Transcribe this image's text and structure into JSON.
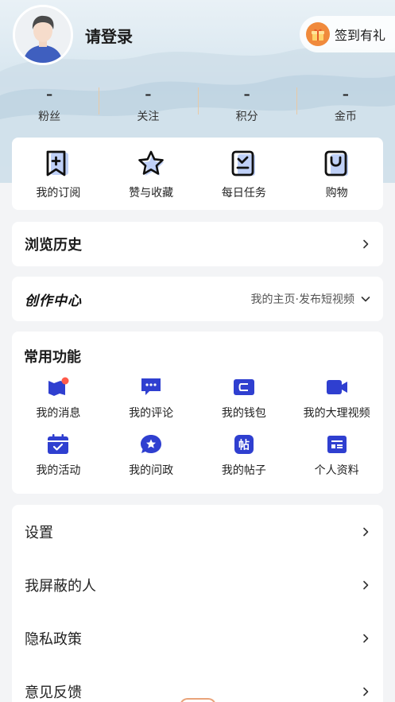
{
  "header": {
    "login_text": "请登录",
    "checkin_label": "签到有礼"
  },
  "stats": [
    {
      "value": "–",
      "label": "粉丝"
    },
    {
      "value": "–",
      "label": "关注"
    },
    {
      "value": "–",
      "label": "积分"
    },
    {
      "value": "–",
      "label": "金币"
    }
  ],
  "quick_actions": [
    {
      "label": "我的订阅",
      "icon": "bookmark-plus-icon"
    },
    {
      "label": "赞与收藏",
      "icon": "star-icon"
    },
    {
      "label": "每日任务",
      "icon": "task-check-icon"
    },
    {
      "label": "购物",
      "icon": "shopping-bag-icon"
    }
  ],
  "history": {
    "title": "浏览历史"
  },
  "creator": {
    "logo_text": "创作中心",
    "right_text": "我的主页·发布短视频"
  },
  "functions": {
    "title": "常用功能",
    "items": [
      {
        "label": "我的消息",
        "icon": "message-icon"
      },
      {
        "label": "我的评论",
        "icon": "comment-icon"
      },
      {
        "label": "我的钱包",
        "icon": "wallet-icon"
      },
      {
        "label": "我的大理视频",
        "icon": "video-icon"
      },
      {
        "label": "我的活动",
        "icon": "calendar-check-icon"
      },
      {
        "label": "我的问政",
        "icon": "question-star-icon"
      },
      {
        "label": "我的帖子",
        "icon": "post-icon"
      },
      {
        "label": "个人资料",
        "icon": "profile-card-icon"
      }
    ]
  },
  "settings": [
    {
      "label": "设置"
    },
    {
      "label": "我屏蔽的人"
    },
    {
      "label": "隐私政策"
    },
    {
      "label": "意见反馈"
    }
  ],
  "colors": {
    "accent_blue": "#2f3fd0",
    "notification_dot": "#ff5a4a",
    "gift_orange": "#f08a3c"
  }
}
